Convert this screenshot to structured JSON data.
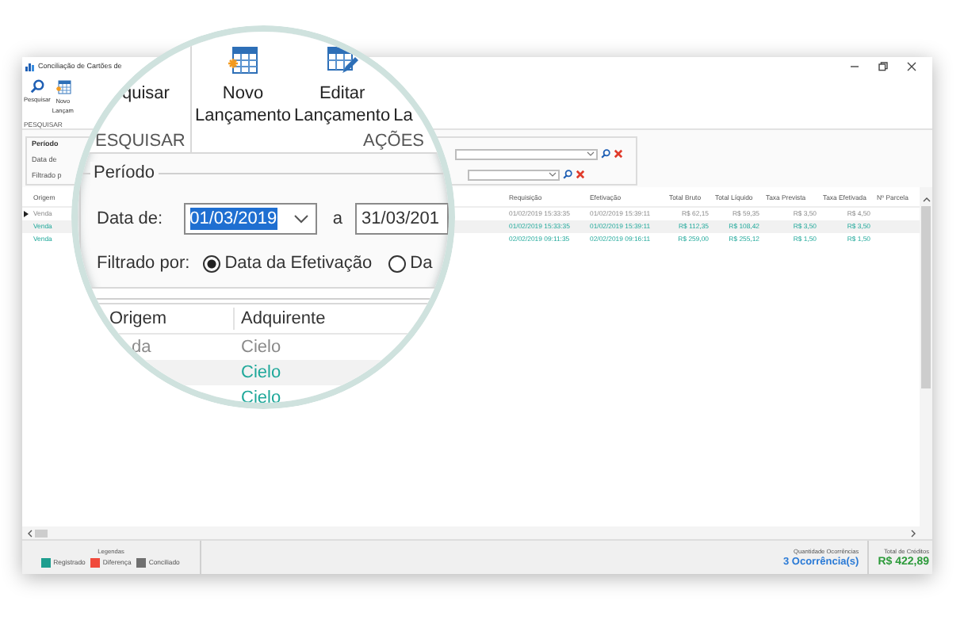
{
  "window": {
    "title": "Conciliação de Cartões de"
  },
  "ribbon": {
    "buttons": [
      {
        "top": "Pesquisar"
      },
      {
        "top": "Novo",
        "bottom": "Lançam"
      }
    ],
    "group_label": "PESQUISAR"
  },
  "filter": {
    "group_title": "Período",
    "date_label": "Data de",
    "filter_label": "Filtrado p"
  },
  "grid": {
    "columns": [
      "Origem",
      "Requisição",
      "Efetivação",
      "Total Bruto",
      "Total Líquido",
      "Taxa Prevista",
      "Taxa Efetivada",
      "Nº Parcela"
    ],
    "rows": [
      {
        "selected": true,
        "kind": "conciliado",
        "cells": [
          "Venda",
          "01/02/2019 15:33:35",
          "01/02/2019 15:39:11",
          "R$ 62,15",
          "R$ 59,35",
          "R$ 3,50",
          "R$ 4,50"
        ]
      },
      {
        "selected": false,
        "kind": "registrado",
        "cells": [
          "Venda",
          "01/02/2019 15:33:35",
          "01/02/2019 15:39:11",
          "R$ 112,35",
          "R$ 108,42",
          "R$ 3,50",
          "R$ 3,50"
        ]
      },
      {
        "selected": false,
        "kind": "registrado",
        "cells": [
          "Venda",
          "02/02/2019 09:11:35",
          "02/02/2019 09:16:11",
          "R$ 259,00",
          "R$ 255,12",
          "R$ 1,50",
          "R$ 1,50"
        ]
      }
    ]
  },
  "status_bar": {
    "legend_title": "Legendas",
    "legend": [
      {
        "label": "Registrado",
        "color": "#1e9e8f"
      },
      {
        "label": "Diferença",
        "color": "#f04a3c"
      },
      {
        "label": "Conciliado",
        "color": "#707070"
      }
    ],
    "count_label": "Quantidade Ocorrências",
    "count": "3 Ocorrência(s)",
    "total_label": "Total de Créditos",
    "total": "R$ 422,89"
  },
  "magnifier": {
    "ribbon_groups": [
      {
        "label": "ESQUISAR",
        "buttons": [
          {
            "top": "quisar"
          }
        ]
      },
      {
        "label": "AÇÕES",
        "buttons": [
          {
            "top": "Novo",
            "bottom": "Lançamento"
          },
          {
            "top": "Editar",
            "bottom": "Lançamento"
          },
          {
            "bottom": "La"
          }
        ]
      }
    ],
    "period_title": "Período",
    "date_from_label": "Data de:",
    "date_from": "01/03/2019",
    "text_selected": true,
    "to_label": "a",
    "date_to": "31/03/201",
    "filter_label": "Filtrado por:",
    "radios": [
      {
        "label": "Data da Efetivação",
        "selected": true
      },
      {
        "label": "Da",
        "selected": false
      }
    ],
    "grid": {
      "columns": [
        "Origem",
        "Adquirente"
      ],
      "rows": [
        {
          "origem": "da",
          "adquirente": "Cielo",
          "kind": "conciliado"
        },
        {
          "adquirente": "Cielo",
          "kind": "registrado"
        },
        {
          "adquirente": "Cielo",
          "kind": "registrado"
        }
      ]
    }
  }
}
